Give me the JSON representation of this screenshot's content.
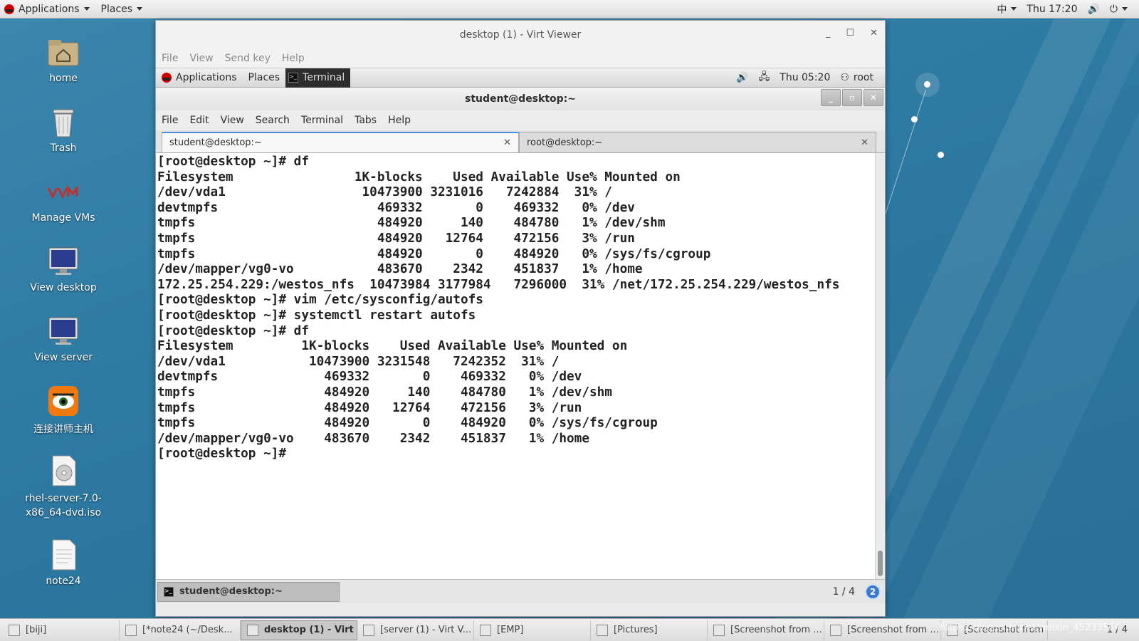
{
  "top_panel": {
    "applications": "Applications",
    "places": "Places",
    "input_method": "中",
    "clock": "Thu 17:20"
  },
  "desktop_icons": [
    {
      "label": "home",
      "icon": "home-folder-icon"
    },
    {
      "label": "Trash",
      "icon": "trash-icon"
    },
    {
      "label": "Manage VMs",
      "icon": "vm-manager-icon"
    },
    {
      "label": "View desktop",
      "icon": "monitor-icon"
    },
    {
      "label": "View server",
      "icon": "monitor-icon"
    },
    {
      "label": "连接讲师主机",
      "icon": "remote-connect-icon"
    },
    {
      "label": "rhel-server-7.0-\nx86_64-dvd.iso",
      "icon": "disc-image-icon"
    },
    {
      "label": "note24",
      "icon": "text-file-icon"
    }
  ],
  "viewer": {
    "title": "desktop (1) - Virt Viewer",
    "menu": [
      "File",
      "View",
      "Send key",
      "Help"
    ]
  },
  "guest_panel": {
    "applications": "Applications",
    "places": "Places",
    "terminal": "Terminal",
    "clock": "Thu 05:20",
    "user": "root"
  },
  "terminal": {
    "title": "student@desktop:~",
    "menu": [
      "File",
      "Edit",
      "View",
      "Search",
      "Terminal",
      "Tabs",
      "Help"
    ],
    "tabs": [
      {
        "label": "student@desktop:~",
        "active": true
      },
      {
        "label": "root@desktop:~",
        "active": false
      }
    ],
    "lines": [
      "[root@desktop ~]# df",
      "Filesystem                1K-blocks    Used Available Use% Mounted on",
      "/dev/vda1                  10473900 3231016   7242884  31% /",
      "devtmpfs                     469332       0    469332   0% /dev",
      "tmpfs                        484920     140    484780   1% /dev/shm",
      "tmpfs                        484920   12764    472156   3% /run",
      "tmpfs                        484920       0    484920   0% /sys/fs/cgroup",
      "/dev/mapper/vg0-vo           483670    2342    451837   1% /home",
      "172.25.254.229:/westos_nfs  10473984 3177984   7296000  31% /net/172.25.254.229/westos_nfs",
      "[root@desktop ~]# vim /etc/sysconfig/autofs",
      "[root@desktop ~]# systemctl restart autofs",
      "[root@desktop ~]# df",
      "Filesystem         1K-blocks    Used Available Use% Mounted on",
      "/dev/vda1           10473900 3231548   7242352  31% /",
      "devtmpfs              469332       0    469332   0% /dev",
      "tmpfs                 484920     140    484780   1% /dev/shm",
      "tmpfs                 484920   12764    472156   3% /run",
      "tmpfs                 484920       0    484920   0% /sys/fs/cgroup",
      "/dev/mapper/vg0-vo    483670    2342    451837   1% /home",
      "[root@desktop ~]#"
    ]
  },
  "guest_bottom": {
    "task": "student@desktop:~",
    "pager": "1 / 4",
    "badge": "2"
  },
  "taskbar": {
    "items": [
      {
        "label": "[biji]",
        "active": false
      },
      {
        "label": "[*note24 (~/Desk...",
        "active": false
      },
      {
        "label": "desktop (1) - Virt ...",
        "active": true
      },
      {
        "label": "[server (1) - Virt V...",
        "active": false
      },
      {
        "label": "[EMP]",
        "active": false
      },
      {
        "label": "[Pictures]",
        "active": false
      },
      {
        "label": "[Screenshot from ...",
        "active": false
      },
      {
        "label": "[Screenshot from ...",
        "active": false
      },
      {
        "label": "[Screenshot from ...",
        "active": false
      }
    ],
    "pager": "1 / 4",
    "watermark": "https://blog.csdn.net/weixin_45233564"
  }
}
